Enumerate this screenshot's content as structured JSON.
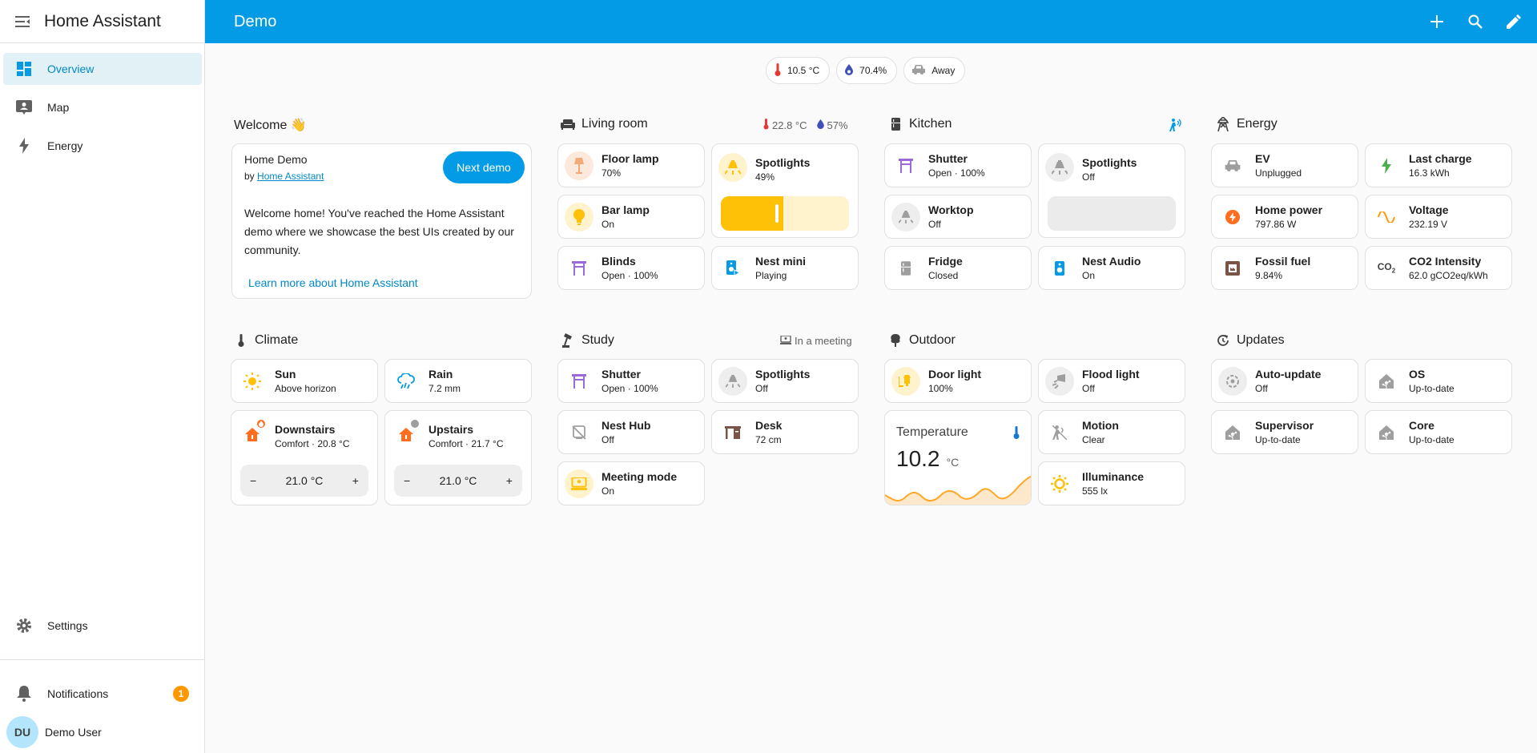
{
  "sidebar": {
    "title": "Home Assistant",
    "items": [
      {
        "label": "Overview"
      },
      {
        "label": "Map"
      },
      {
        "label": "Energy"
      }
    ],
    "settings_label": "Settings",
    "notifications_label": "Notifications",
    "notifications_count": "1",
    "user_initials": "DU",
    "user_name": "Demo User"
  },
  "header": {
    "title": "Demo"
  },
  "badges": [
    {
      "icon": "thermometer-icon",
      "value": "10.5 °C"
    },
    {
      "icon": "water-drop-icon",
      "value": "70.4%"
    },
    {
      "icon": "car-icon",
      "value": "Away"
    }
  ],
  "welcome": {
    "title": "Welcome 👋",
    "card_title": "Home Demo",
    "by_prefix": "by",
    "by_link": "Home Assistant",
    "next_demo": "Next demo",
    "body": "Welcome home! You've reached the Home Assistant demo where we showcase the best UIs created by our community.",
    "learn_more": "Learn more about Home Assistant"
  },
  "living_room": {
    "title": "Living room",
    "temp": "22.8 °C",
    "humidity": "57%",
    "tiles": [
      {
        "name": "Floor lamp",
        "state": "70%"
      },
      {
        "name": "Spotlights",
        "state": "49%"
      },
      {
        "name": "Bar lamp",
        "state": "On"
      },
      {
        "name": "Blinds",
        "state": "Open · 100%"
      },
      {
        "name": "Nest mini",
        "state": "Playing"
      }
    ],
    "spotlight_brightness": 0.49
  },
  "kitchen": {
    "title": "Kitchen",
    "tiles": [
      {
        "name": "Shutter",
        "state": "Open · 100%"
      },
      {
        "name": "Spotlights",
        "state": "Off"
      },
      {
        "name": "Worktop",
        "state": "Off"
      },
      {
        "name": "Fridge",
        "state": "Closed"
      },
      {
        "name": "Nest Audio",
        "state": "On"
      }
    ]
  },
  "energy": {
    "title": "Energy",
    "tiles": [
      {
        "name": "EV",
        "state": "Unplugged"
      },
      {
        "name": "Last charge",
        "state": "16.3 kWh"
      },
      {
        "name": "Home power",
        "state": "797.86 W"
      },
      {
        "name": "Voltage",
        "state": "232.19 V"
      },
      {
        "name": "Fossil fuel",
        "state": "9.84%"
      },
      {
        "name": "CO2 Intensity",
        "state": "62.0 gCO2eq/kWh"
      }
    ]
  },
  "climate": {
    "title": "Climate",
    "tiles": [
      {
        "name": "Sun",
        "state": "Above horizon"
      },
      {
        "name": "Rain",
        "state": "7.2 mm"
      },
      {
        "name": "Downstairs",
        "state": "Comfort · 20.8 °C",
        "target": "21.0 °C"
      },
      {
        "name": "Upstairs",
        "state": "Comfort · 21.7 °C",
        "target": "21.0 °C"
      }
    ],
    "minus": "−",
    "plus": "+"
  },
  "study": {
    "title": "Study",
    "meta": "In a meeting",
    "tiles": [
      {
        "name": "Shutter",
        "state": "Open · 100%"
      },
      {
        "name": "Spotlights",
        "state": "Off"
      },
      {
        "name": "Nest Hub",
        "state": "Off"
      },
      {
        "name": "Desk",
        "state": "72 cm"
      },
      {
        "name": "Meeting mode",
        "state": "On"
      }
    ]
  },
  "outdoor": {
    "title": "Outdoor",
    "tiles": [
      {
        "name": "Door light",
        "state": "100%"
      },
      {
        "name": "Flood light",
        "state": "Off"
      },
      {
        "name": "Motion",
        "state": "Clear"
      },
      {
        "name": "Illuminance",
        "state": "555 lx"
      }
    ],
    "sensor": {
      "label": "Temperature",
      "value": "10.2",
      "unit": "°C"
    }
  },
  "updates": {
    "title": "Updates",
    "tiles": [
      {
        "name": "Auto-update",
        "state": "Off"
      },
      {
        "name": "OS",
        "state": "Up-to-date"
      },
      {
        "name": "Supervisor",
        "state": "Up-to-date"
      },
      {
        "name": "Core",
        "state": "Up-to-date"
      }
    ]
  },
  "colors": {
    "primary": "#039be5",
    "accent_yellow": "#ffc107",
    "orange": "#ff9800"
  }
}
